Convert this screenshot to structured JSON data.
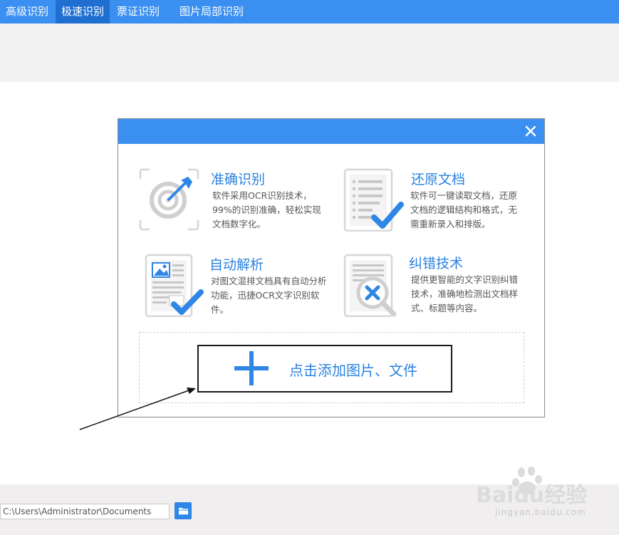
{
  "tabs": [
    {
      "label": "高级识别",
      "active": false
    },
    {
      "label": "极速识别",
      "active": true
    },
    {
      "label": "票证识别",
      "active": false
    },
    {
      "label": "图片局部识别",
      "active": false
    }
  ],
  "dialog": {
    "features": [
      {
        "title": "准确识别",
        "desc": "软件采用OCR识别技术，99%的识别准确，轻松实现文档数字化。",
        "icon": "target-icon"
      },
      {
        "title": "还原文档",
        "desc": "软件可一键读取文档，还原文档的逻辑结构和格式，无需重新录入和排版。",
        "icon": "document-check-icon"
      },
      {
        "title": "自动解析",
        "desc": "对图文混排文档具有自动分析功能，迅捷OCR文字识别软件。",
        "icon": "image-document-check-icon"
      },
      {
        "title": "纠错技术",
        "desc": "提供更智能的文字识别纠错技术，准确地检测出文档样式、标题等内容。",
        "icon": "document-magnifier-error-icon"
      }
    ],
    "add_label": "点击添加图片、文件"
  },
  "bottom": {
    "path_value": "C:\\Users\\Administrator\\Documents"
  },
  "watermark": {
    "logo": "Baidu经验",
    "url": "jingyan.baidu.com"
  },
  "colors": {
    "accent": "#3a8ff0",
    "active_tab": "#1f6fd1",
    "title_blue": "#2b82e0"
  }
}
